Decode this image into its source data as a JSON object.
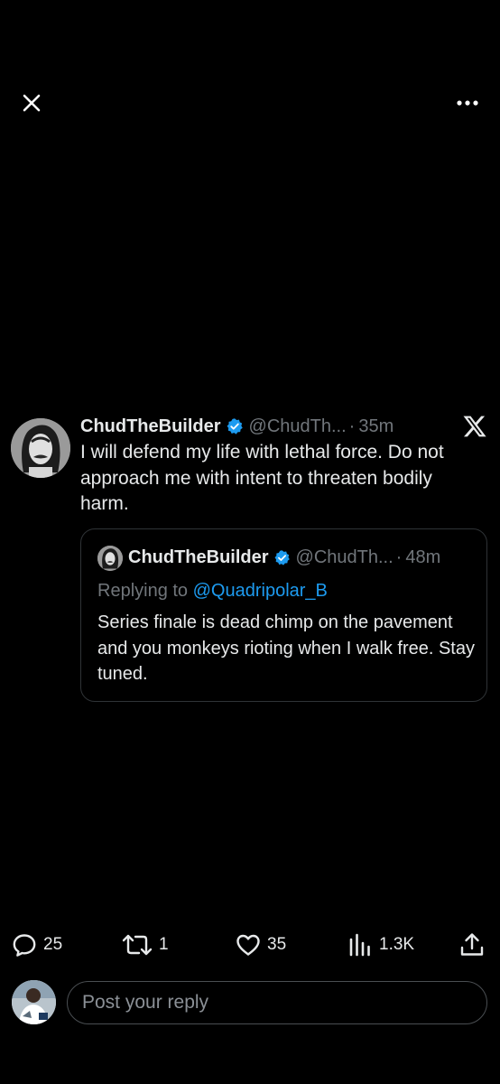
{
  "icons": {
    "close": "close-icon",
    "more": "more-dots-icon",
    "platform": "x-logo-icon",
    "verified": "verified-badge-icon",
    "reply": "reply-bubble-icon",
    "repost": "repost-icon",
    "like": "heart-icon",
    "views": "views-bar-chart-icon",
    "share": "share-upload-icon"
  },
  "colors": {
    "background": "#000000",
    "text_primary": "#e7e9ea",
    "text_secondary": "#71767b",
    "accent": "#1d9bf0",
    "border": "#2f3336"
  },
  "tweet": {
    "display_name": "ChudTheBuilder",
    "handle": "@ChudTh...",
    "separator": "·",
    "time": "35m",
    "text": "I will defend my life with lethal force. Do not approach me with intent to threaten bodily harm."
  },
  "quoted_tweet": {
    "display_name": "ChudTheBuilder",
    "handle": "@ChudTh...",
    "separator": "·",
    "time": "48m",
    "replying_prefix": "Replying to ",
    "replying_to": "@Quadripolar_B",
    "text": "Series finale is dead chimp on the pavement and you monkeys rioting when I walk free. Stay tuned."
  },
  "actions": {
    "replies": "25",
    "reposts": "1",
    "likes": "35",
    "views": "1.3K"
  },
  "reply_box": {
    "placeholder": "Post your reply"
  }
}
